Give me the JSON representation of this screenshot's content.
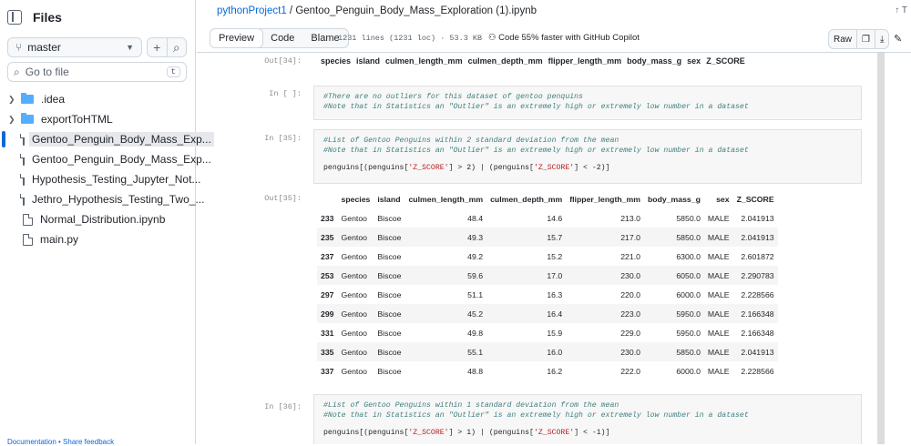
{
  "sidebar": {
    "title": "Files",
    "branch": "master",
    "go_to_file_placeholder": "Go to file",
    "go_to_file_key": "t",
    "items": [
      {
        "label": ".idea",
        "type": "folder"
      },
      {
        "label": "exportToHTML",
        "type": "folder"
      },
      {
        "label": "Gentoo_Penguin_Body_Mass_Exp...",
        "type": "file",
        "selected": true
      },
      {
        "label": "Gentoo_Penguin_Body_Mass_Exp...",
        "type": "file"
      },
      {
        "label": "Hypothesis_Testing_Jupyter_Not...",
        "type": "file"
      },
      {
        "label": "Jethro_Hypothesis_Testing_Two_...",
        "type": "file"
      },
      {
        "label": "Normal_Distribution.ipynb",
        "type": "file"
      },
      {
        "label": "main.py",
        "type": "file"
      }
    ],
    "footer": "Documentation • Share feedback"
  },
  "breadcrumb": {
    "repo": "pythonProject1",
    "sep": " / ",
    "file": "Gentoo_Penguin_Body_Mass_Exploration (1).ipynb"
  },
  "top_right": "↑ T",
  "toolbar": {
    "tabs": [
      "Preview",
      "Code",
      "Blame"
    ],
    "file_info": "1231 lines (1231 loc) · 53.3 KB",
    "copilot": "Code 55% faster with GitHub Copilot",
    "raw": "Raw"
  },
  "notebook": {
    "out34_prompt": "Out[34]:",
    "out34_headers": [
      "species",
      "island",
      "culmen_length_mm",
      "culmen_depth_mm",
      "flipper_length_mm",
      "body_mass_g",
      "sex",
      "Z_SCORE"
    ],
    "in_blank_prompt": "In [ ]:",
    "in_blank_lines": [
      "#There are no outliers for this dataset of gentoo penquins",
      "#Note that in Statistics an \"Outlier\" is an extremely high or extremely low number in a dataset"
    ],
    "in35_prompt": "In [35]:",
    "in35_comments": [
      "#List of Gentoo Penguins within 2 standard deviation from the mean",
      "#Note that in Statistics an \"Outlier\" is an extremely high or extremely low number in a dataset"
    ],
    "in35_code": "penguins[(penguins['Z_SCORE'] > 2) | (penguins['Z_SCORE'] < -2)]",
    "out35_prompt": "Out[35]:",
    "out35_table": {
      "headers": [
        "",
        "species",
        "island",
        "culmen_length_mm",
        "culmen_depth_mm",
        "flipper_length_mm",
        "body_mass_g",
        "sex",
        "Z_SCORE"
      ],
      "rows": [
        [
          "233",
          "Gentoo",
          "Biscoe",
          "48.4",
          "14.6",
          "213.0",
          "5850.0",
          "MALE",
          "2.041913"
        ],
        [
          "235",
          "Gentoo",
          "Biscoe",
          "49.3",
          "15.7",
          "217.0",
          "5850.0",
          "MALE",
          "2.041913"
        ],
        [
          "237",
          "Gentoo",
          "Biscoe",
          "49.2",
          "15.2",
          "221.0",
          "6300.0",
          "MALE",
          "2.601872"
        ],
        [
          "253",
          "Gentoo",
          "Biscoe",
          "59.6",
          "17.0",
          "230.0",
          "6050.0",
          "MALE",
          "2.290783"
        ],
        [
          "297",
          "Gentoo",
          "Biscoe",
          "51.1",
          "16.3",
          "220.0",
          "6000.0",
          "MALE",
          "2.228566"
        ],
        [
          "299",
          "Gentoo",
          "Biscoe",
          "45.2",
          "16.4",
          "223.0",
          "5950.0",
          "MALE",
          "2.166348"
        ],
        [
          "331",
          "Gentoo",
          "Biscoe",
          "49.8",
          "15.9",
          "229.0",
          "5950.0",
          "MALE",
          "2.166348"
        ],
        [
          "335",
          "Gentoo",
          "Biscoe",
          "55.1",
          "16.0",
          "230.0",
          "5850.0",
          "MALE",
          "2.041913"
        ],
        [
          "337",
          "Gentoo",
          "Biscoe",
          "48.8",
          "16.2",
          "222.0",
          "6000.0",
          "MALE",
          "2.228566"
        ]
      ]
    },
    "in36_prompt": "In [36]:",
    "in36_comments": [
      "#List of Gentoo Penguins within 1 standard deviation from the mean",
      "#Note that in Statistics an \"Outlier\" is an extremely high or extremely low number in a dataset"
    ],
    "in36_code": "penguins[(penguins['Z_SCORE'] > 1) | (penguins['Z_SCORE'] < -1)]"
  }
}
